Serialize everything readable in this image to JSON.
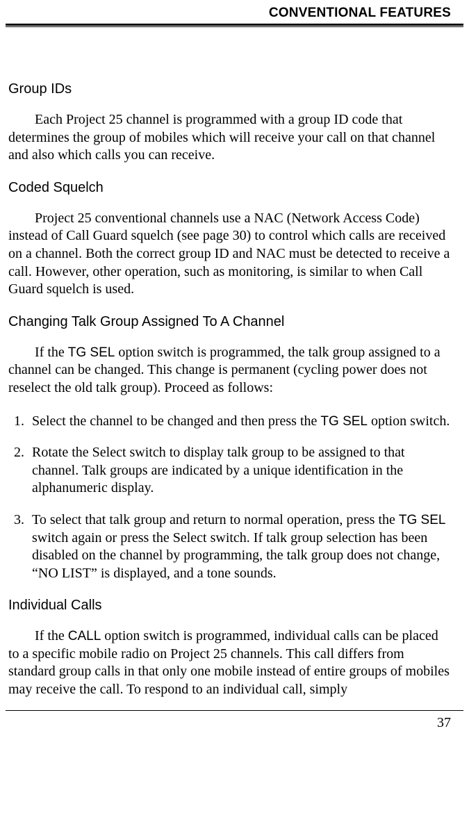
{
  "running_header": "CONVENTIONAL FEATURES",
  "sections": {
    "group_ids": {
      "title": "Group IDs",
      "body": "Each Project 25 channel is programmed with a group ID code that determines the group of mobiles which will receive your call on that channel and also which calls you can receive."
    },
    "coded_squelch": {
      "title": "Coded Squelch",
      "body": "Project 25 conventional channels use a NAC (Network Access Code) instead of Call Guard squelch (see page 30) to control which calls are received on a channel. Both the correct group ID and NAC must be detected to receive a call. However, other operation, such as monitoring, is similar to when Call Guard squelch is used."
    },
    "changing_tg": {
      "title": "Changing Talk Group Assigned To A Channel",
      "intro_pre": "If the ",
      "intro_sf1": "TG SEL",
      "intro_post": " option switch is programmed, the talk group assigned to a channel can be changed. This change is permanent (cycling power does not reselect the old talk group). Proceed as follows:",
      "steps": {
        "s1_pre": "Select the channel to be changed and then press the ",
        "s1_sf": "TG SEL",
        "s1_post": " option switch.",
        "s2": "Rotate the Select switch to display talk group to be assigned to that channel. Talk groups are indicated by a unique identification in the alphanumeric display.",
        "s3_pre": "To select that talk group and return to normal operation, press the ",
        "s3_sf": "TG SEL",
        "s3_post": " switch again or press the Select switch. If talk group selection has been disabled on the channel by programming, the talk group does not change, “NO LIST” is displayed, and a tone sounds."
      }
    },
    "individual_calls": {
      "title": "Individual Calls",
      "intro_pre": "If the ",
      "intro_sf": "CALL",
      "intro_post": " option switch is programmed, individual calls can be placed to a specific mobile radio on Project 25 channels. This call differs from standard group calls in that only one mobile instead of entire groups of mobiles may receive the call. To respond to an individual call, simply"
    }
  },
  "page_number": "37"
}
